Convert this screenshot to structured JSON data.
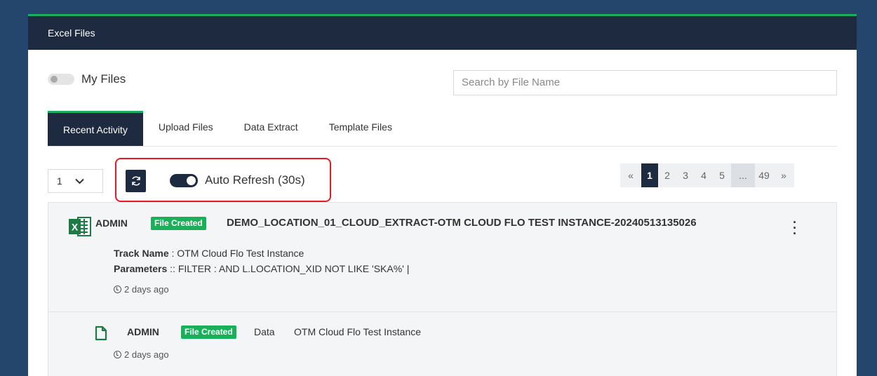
{
  "panel": {
    "title": "Excel Files"
  },
  "filters": {
    "my_files_label": "My Files",
    "search_placeholder": "Search by File Name"
  },
  "tabs": [
    {
      "label": "Recent Activity",
      "active": true
    },
    {
      "label": "Upload Files",
      "active": false
    },
    {
      "label": "Data Extract",
      "active": false
    },
    {
      "label": "Template Files",
      "active": false
    }
  ],
  "toolbar": {
    "page_size_value": "1",
    "auto_refresh_label": "Auto Refresh (30s)",
    "auto_refresh_on": true
  },
  "pagination": {
    "prev": "«",
    "pages": [
      "1",
      "2",
      "3",
      "4",
      "5"
    ],
    "ellipsis": "...",
    "last": "49",
    "next": "»",
    "current": "1"
  },
  "activity": {
    "row1": {
      "excel_icon_letter": "X",
      "user": "ADMIN",
      "badge": "File Created",
      "title": "DEMO_LOCATION_01_CLOUD_EXTRACT-OTM CLOUD FLO TEST INSTANCE-20240513135026",
      "track_label": "Track Name",
      "track_value": ": OTM Cloud Flo Test Instance",
      "params_label": "Parameters",
      "params_value": ":: FILTER : AND L.LOCATION_XID NOT LIKE 'SKA%' |",
      "time": "2 days ago"
    },
    "row2": {
      "user": "ADMIN",
      "badge": "File Created",
      "type": "Data",
      "track": "OTM Cloud Flo Test Instance",
      "time": "2 days ago"
    }
  },
  "colors": {
    "page_bg": "#24466d",
    "header_bg": "#1e2a3f",
    "accent_green": "#1ab05a",
    "highlight_red": "#e51a22"
  }
}
